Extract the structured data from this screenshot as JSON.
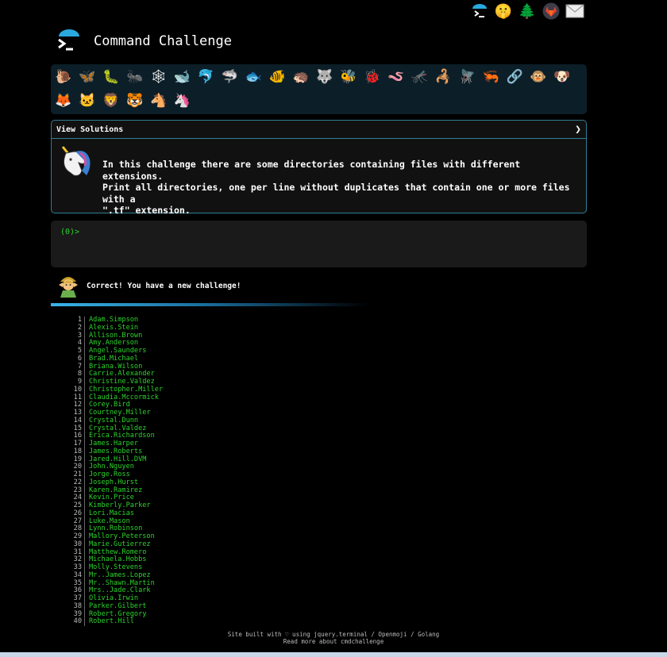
{
  "topbar": {
    "icons": [
      {
        "name": "terminal-icon",
        "glyph": ""
      },
      {
        "name": "shush-emoji-icon",
        "glyph": "🤫"
      },
      {
        "name": "tree-icon",
        "glyph": "🌲"
      },
      {
        "name": "gitlab-icon",
        "glyph": ""
      },
      {
        "name": "mail-icon",
        "glyph": "✉"
      }
    ]
  },
  "header": {
    "title": "Command Challenge"
  },
  "levels": [
    {
      "name": "snail",
      "glyph": "🐌"
    },
    {
      "name": "butterfly",
      "glyph": "🦋"
    },
    {
      "name": "caterpillar",
      "glyph": "🐛"
    },
    {
      "name": "ant",
      "glyph": "🐜"
    },
    {
      "name": "spider-web",
      "glyph": "🕸"
    },
    {
      "name": "whale",
      "glyph": "🐋"
    },
    {
      "name": "dolphin",
      "glyph": "🐬"
    },
    {
      "name": "shark",
      "glyph": "🦈"
    },
    {
      "name": "fish",
      "glyph": "🐟"
    },
    {
      "name": "tropical-fish",
      "glyph": "🐠"
    },
    {
      "name": "hedgehog",
      "glyph": "🦔"
    },
    {
      "name": "wolf",
      "glyph": "🐺"
    },
    {
      "name": "bee",
      "glyph": "🐝"
    },
    {
      "name": "ladybug",
      "glyph": "🐞"
    },
    {
      "name": "worm",
      "glyph": "🪱"
    },
    {
      "name": "mosquito",
      "glyph": "🦟"
    },
    {
      "name": "scorpion",
      "glyph": "🦂"
    },
    {
      "name": "fly",
      "glyph": "🪰"
    },
    {
      "name": "shrimp",
      "glyph": "🦐"
    },
    {
      "name": "link",
      "glyph": "🔗"
    },
    {
      "name": "monkey",
      "glyph": "🐵"
    },
    {
      "name": "dog",
      "glyph": "🐶"
    },
    {
      "name": "fox",
      "glyph": "🦊"
    },
    {
      "name": "cat",
      "glyph": "🐱"
    },
    {
      "name": "lion",
      "glyph": "🦁"
    },
    {
      "name": "tiger",
      "glyph": "🐯"
    },
    {
      "name": "horse",
      "glyph": "🐴"
    },
    {
      "name": "unicorn",
      "glyph": "🦄"
    }
  ],
  "solutions": {
    "label": "View Solutions",
    "chevron": "❯"
  },
  "challenge": {
    "lines": [
      "In this challenge there are some directories containing files with different extensions.",
      "Print all directories, one per line without duplicates that contain one or more files with a",
      "\".tf\" extension."
    ]
  },
  "terminal": {
    "prompt": "(0)>"
  },
  "feedback": {
    "text": "Correct! You have a new challenge!"
  },
  "output": [
    {
      "n": "1",
      "v": "Adam.Simpson"
    },
    {
      "n": "2",
      "v": "Alexis.Stein"
    },
    {
      "n": "3",
      "v": "Allison.Brown"
    },
    {
      "n": "4",
      "v": "Amy.Anderson"
    },
    {
      "n": "5",
      "v": "Angel.Saunders"
    },
    {
      "n": "6",
      "v": "Brad.Michael"
    },
    {
      "n": "7",
      "v": "Briana.Wilson"
    },
    {
      "n": "8",
      "v": "Carrie.Alexander"
    },
    {
      "n": "9",
      "v": "Christine.Valdez"
    },
    {
      "n": "10",
      "v": "Christopher.Miller"
    },
    {
      "n": "11",
      "v": "Claudia.Mccormick"
    },
    {
      "n": "12",
      "v": "Corey.Bird"
    },
    {
      "n": "13",
      "v": "Courtney.Miller"
    },
    {
      "n": "14",
      "v": "Crystal.Dunn"
    },
    {
      "n": "15",
      "v": "Crystal.Valdez"
    },
    {
      "n": "16",
      "v": "Erica.Richardson"
    },
    {
      "n": "17",
      "v": "James.Harper"
    },
    {
      "n": "18",
      "v": "James.Roberts"
    },
    {
      "n": "19",
      "v": "Jared.Hill.DVM"
    },
    {
      "n": "20",
      "v": "John.Nguyen"
    },
    {
      "n": "21",
      "v": "Jorge.Ross"
    },
    {
      "n": "22",
      "v": "Joseph.Hurst"
    },
    {
      "n": "23",
      "v": "Karen.Ramirez"
    },
    {
      "n": "24",
      "v": "Kevin.Price"
    },
    {
      "n": "25",
      "v": "Kimberly.Parker"
    },
    {
      "n": "26",
      "v": "Lori.Macias"
    },
    {
      "n": "27",
      "v": "Luke.Mason"
    },
    {
      "n": "28",
      "v": "Lynn.Robinson"
    },
    {
      "n": "29",
      "v": "Mallory.Peterson"
    },
    {
      "n": "30",
      "v": "Marie.Gutierrez"
    },
    {
      "n": "31",
      "v": "Matthew.Romero"
    },
    {
      "n": "32",
      "v": "Michaela.Hobbs"
    },
    {
      "n": "33",
      "v": "Molly.Stevens"
    },
    {
      "n": "34",
      "v": "Mr..James.Lopez"
    },
    {
      "n": "35",
      "v": "Mr..Shawn.Martin"
    },
    {
      "n": "36",
      "v": "Mrs..Jade.Clark"
    },
    {
      "n": "37",
      "v": "Olivia.Irwin"
    },
    {
      "n": "38",
      "v": "Parker.Gilbert"
    },
    {
      "n": "39",
      "v": "Robert.Gregory"
    },
    {
      "n": "40",
      "v": "Robert.Hill"
    }
  ],
  "footer": {
    "line1": "Site built with ♡ using jquery.terminal / Openmoji / Golang",
    "line2": "Read more about cmdchallenge"
  }
}
